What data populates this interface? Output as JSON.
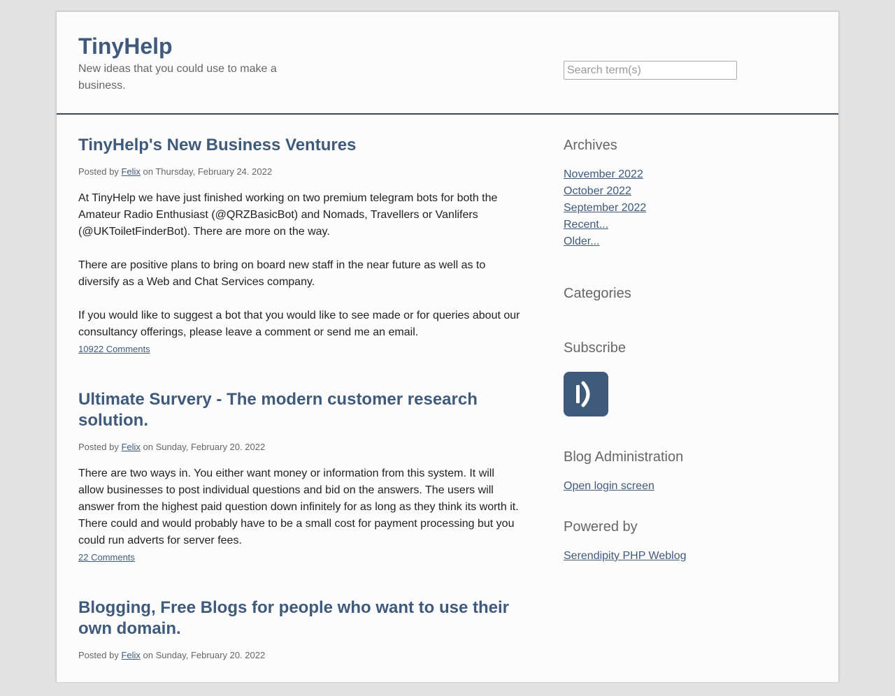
{
  "header": {
    "site_title": "TinyHelp",
    "site_description": "New ideas that you could use to make a business.",
    "search_placeholder": "Search term(s)"
  },
  "posts": [
    {
      "title": "TinyHelp's New Business Ventures",
      "meta_prefix": "Posted by",
      "author": "Felix",
      "meta_suffix": "on Thursday, February 24. 2022",
      "paragraphs": [
        "At TinyHelp we have just finished working on two premium telegram bots for both the Amateur Radio Enthusiast (@QRZBasicBot) and Nomads, Travellers or Vanlifers (@UKToiletFinderBot). There are more on the way.",
        "There are positive plans to bring on board new staff in the near future as well as to diversify as a Web and Chat Services company.",
        "If you would like to suggest a bot that you would like to see made or for queries about our consultancy offerings, please leave a comment or send me an email."
      ],
      "comments": "10922 Comments"
    },
    {
      "title": "Ultimate Survery - The modern customer research solution.",
      "meta_prefix": "Posted by",
      "author": "Felix",
      "meta_suffix": "on Sunday, February 20. 2022",
      "paragraphs": [
        "There are two ways in. You either want money or information from this system. It will allow businesses to post individual questions and bid on the answers. The users will answer from the highest paid question down infinitely for as long as they think its worth it. There could and would probably have to be a small cost for payment processing but you could run adverts for server fees."
      ],
      "comments": "22 Comments"
    },
    {
      "title": "Blogging, Free Blogs for people who want to use their own domain.",
      "meta_prefix": "Posted by",
      "author": "Felix",
      "meta_suffix": "on Sunday, February 20. 2022"
    }
  ],
  "sidebar": {
    "archives": {
      "title": "Archives",
      "items": [
        "November 2022",
        "October 2022",
        "September 2022",
        "Recent...",
        "Older..."
      ]
    },
    "categories": {
      "title": "Categories"
    },
    "subscribe": {
      "title": "Subscribe",
      "icon": "rss-feed-icon"
    },
    "blog_admin": {
      "title": "Blog Administration",
      "link": "Open login screen"
    },
    "powered_by": {
      "title": "Powered by",
      "link": "Serendipity PHP Weblog"
    }
  },
  "colors": {
    "accent": "#3f5a7a",
    "header_border": "#36495a",
    "background": "#e2e2e2",
    "page": "#fcfcfc"
  }
}
